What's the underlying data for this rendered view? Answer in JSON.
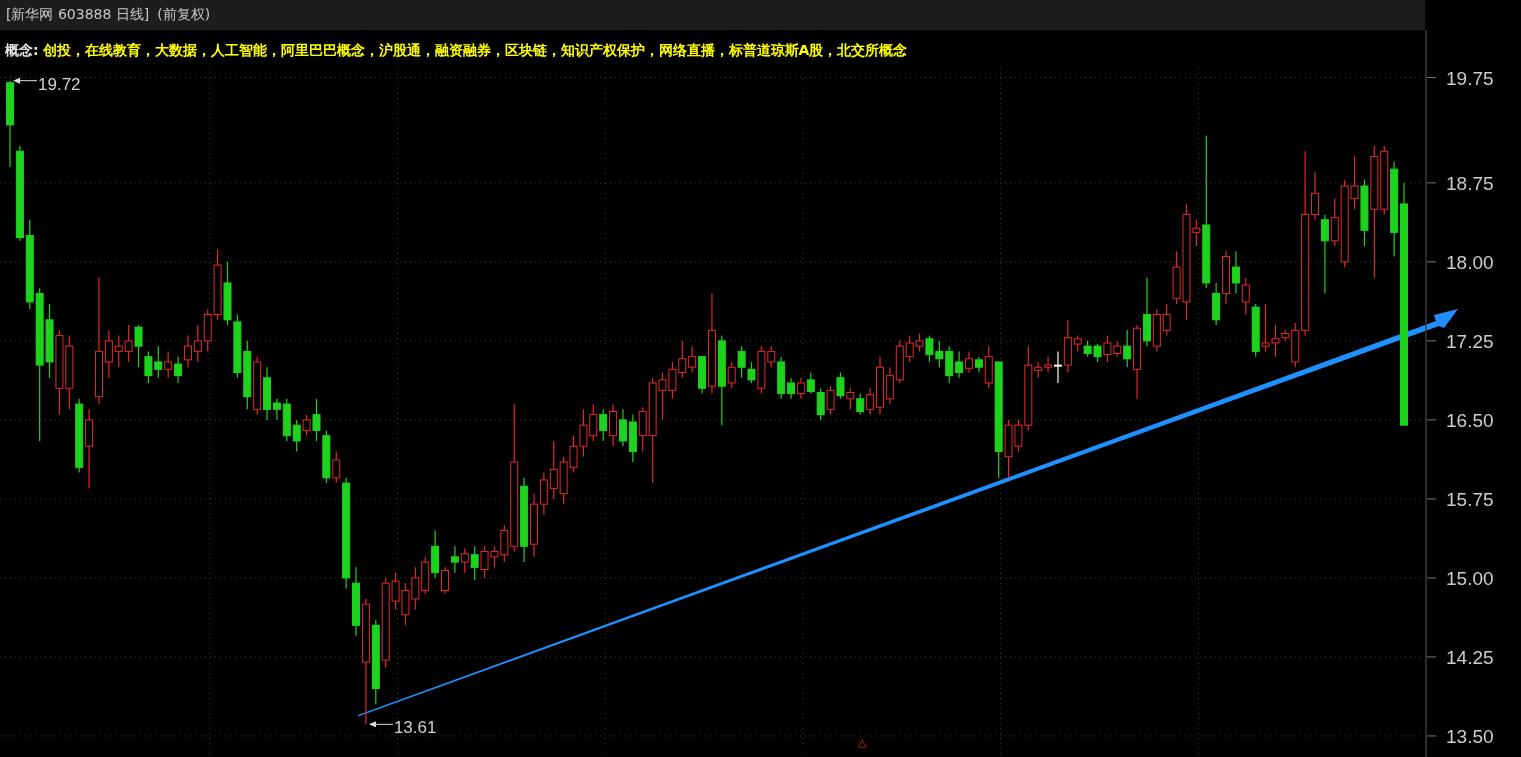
{
  "header": {
    "title": "[新华网 603888 日线]",
    "adjustment": "(前复权)"
  },
  "concepts": {
    "label": "概念:",
    "text": "创投，在线教育，大数据，人工智能，阿里巴巴概念，沪股通，融资融券，区块链，知识产权保护，网络直播，标普道琼斯A股，北交所概念"
  },
  "chart": {
    "bottom_marker": "△",
    "chart_data": {
      "type": "candlestick",
      "ylim": [
        13.3,
        20.48
      ],
      "grid": true,
      "yticks": [
        {
          "value": 19.75,
          "label": "19.75"
        },
        {
          "value": 18.75,
          "label": "18.75"
        },
        {
          "value": 18.0,
          "label": "18.00"
        },
        {
          "value": 17.25,
          "label": "17.25"
        },
        {
          "value": 16.5,
          "label": "16.50"
        },
        {
          "value": 15.75,
          "label": "15.75"
        },
        {
          "value": 15.0,
          "label": "15.00"
        },
        {
          "value": 14.25,
          "label": "14.25"
        },
        {
          "value": 13.5,
          "label": "13.50"
        }
      ],
      "ohlc": [
        [
          19.7,
          19.72,
          18.9,
          19.3
        ],
        [
          19.05,
          19.1,
          18.2,
          18.23
        ],
        [
          18.25,
          18.4,
          17.55,
          17.62
        ],
        [
          17.7,
          17.75,
          16.3,
          17.02
        ],
        [
          17.45,
          17.6,
          16.9,
          17.05
        ],
        [
          16.8,
          17.35,
          16.55,
          17.3
        ],
        [
          16.8,
          17.3,
          16.6,
          17.2
        ],
        [
          16.65,
          16.7,
          16.0,
          16.05
        ],
        [
          16.25,
          16.6,
          15.85,
          16.5
        ],
        [
          16.72,
          17.85,
          16.65,
          17.15
        ],
        [
          17.05,
          17.35,
          16.9,
          17.25
        ],
        [
          17.15,
          17.3,
          17.0,
          17.2
        ],
        [
          17.15,
          17.4,
          17.05,
          17.25
        ],
        [
          17.38,
          17.4,
          17.0,
          17.2
        ],
        [
          17.1,
          17.15,
          16.85,
          16.92
        ],
        [
          17.05,
          17.2,
          16.9,
          16.98
        ],
        [
          16.98,
          17.15,
          16.9,
          17.05
        ],
        [
          17.03,
          17.1,
          16.85,
          16.92
        ],
        [
          17.07,
          17.3,
          17.0,
          17.2
        ],
        [
          17.15,
          17.4,
          17.05,
          17.25
        ],
        [
          17.25,
          17.55,
          17.15,
          17.5
        ],
        [
          17.5,
          18.12,
          17.45,
          17.97
        ],
        [
          17.8,
          18.0,
          17.4,
          17.45
        ],
        [
          17.43,
          17.5,
          16.9,
          16.95
        ],
        [
          17.15,
          17.25,
          16.6,
          16.72
        ],
        [
          16.6,
          17.1,
          16.55,
          17.05
        ],
        [
          16.9,
          17.0,
          16.5,
          16.6
        ],
        [
          16.66,
          16.7,
          16.5,
          16.6
        ],
        [
          16.65,
          16.7,
          16.3,
          16.35
        ],
        [
          16.45,
          16.5,
          16.2,
          16.3
        ],
        [
          16.4,
          16.55,
          16.35,
          16.5
        ],
        [
          16.55,
          16.7,
          16.3,
          16.4
        ],
        [
          16.35,
          16.4,
          15.9,
          15.95
        ],
        [
          15.95,
          16.2,
          15.9,
          16.12
        ],
        [
          15.9,
          15.95,
          14.9,
          15.0
        ],
        [
          14.95,
          15.1,
          14.45,
          14.55
        ],
        [
          14.2,
          14.8,
          13.61,
          14.75
        ],
        [
          14.55,
          14.6,
          13.8,
          13.95
        ],
        [
          14.22,
          15.0,
          14.15,
          14.95
        ],
        [
          14.78,
          15.05,
          14.7,
          14.97
        ],
        [
          14.65,
          14.95,
          14.55,
          14.88
        ],
        [
          14.8,
          15.1,
          14.7,
          15.0
        ],
        [
          14.88,
          15.2,
          14.85,
          15.15
        ],
        [
          15.3,
          15.45,
          15.0,
          15.05
        ],
        [
          14.88,
          15.1,
          14.85,
          15.07
        ],
        [
          15.2,
          15.3,
          15.05,
          15.15
        ],
        [
          15.15,
          15.28,
          15.05,
          15.23
        ],
        [
          15.22,
          15.3,
          14.98,
          15.1
        ],
        [
          15.08,
          15.3,
          15.0,
          15.25
        ],
        [
          15.2,
          15.3,
          15.1,
          15.25
        ],
        [
          15.22,
          15.5,
          15.15,
          15.45
        ],
        [
          15.3,
          16.65,
          15.25,
          16.1
        ],
        [
          15.87,
          15.95,
          15.15,
          15.3
        ],
        [
          15.32,
          15.8,
          15.2,
          15.7
        ],
        [
          15.7,
          16.0,
          15.6,
          15.93
        ],
        [
          15.85,
          16.3,
          15.75,
          16.03
        ],
        [
          15.8,
          16.15,
          15.7,
          16.1
        ],
        [
          16.05,
          16.35,
          16.0,
          16.25
        ],
        [
          16.25,
          16.6,
          16.15,
          16.45
        ],
        [
          16.35,
          16.65,
          16.3,
          16.55
        ],
        [
          16.55,
          16.6,
          16.3,
          16.4
        ],
        [
          16.35,
          16.65,
          16.25,
          16.58
        ],
        [
          16.5,
          16.6,
          16.25,
          16.3
        ],
        [
          16.48,
          16.55,
          16.1,
          16.2
        ],
        [
          16.35,
          16.62,
          16.2,
          16.58
        ],
        [
          16.35,
          16.9,
          15.9,
          16.85
        ],
        [
          16.78,
          16.95,
          16.5,
          16.88
        ],
        [
          16.78,
          17.05,
          16.7,
          16.98
        ],
        [
          16.95,
          17.25,
          16.9,
          17.08
        ],
        [
          17.0,
          17.2,
          16.95,
          17.1
        ],
        [
          17.1,
          17.1,
          16.75,
          16.8
        ],
        [
          16.82,
          17.7,
          16.75,
          17.35
        ],
        [
          17.25,
          17.3,
          16.45,
          16.82
        ],
        [
          16.85,
          17.05,
          16.8,
          17.0
        ],
        [
          17.15,
          17.2,
          16.9,
          17.0
        ],
        [
          16.98,
          17.05,
          16.85,
          16.88
        ],
        [
          16.8,
          17.2,
          16.75,
          17.15
        ],
        [
          17.05,
          17.2,
          17.0,
          17.15
        ],
        [
          17.05,
          17.1,
          16.7,
          16.75
        ],
        [
          16.85,
          16.9,
          16.7,
          16.75
        ],
        [
          16.75,
          16.9,
          16.7,
          16.85
        ],
        [
          16.88,
          16.95,
          16.75,
          16.77
        ],
        [
          16.76,
          16.8,
          16.5,
          16.55
        ],
        [
          16.6,
          16.82,
          16.55,
          16.78
        ],
        [
          16.9,
          16.95,
          16.7,
          16.73
        ],
        [
          16.7,
          16.8,
          16.6,
          16.76
        ],
        [
          16.7,
          16.75,
          16.55,
          16.58
        ],
        [
          16.6,
          16.8,
          16.55,
          16.74
        ],
        [
          16.62,
          17.1,
          16.55,
          17.0
        ],
        [
          16.7,
          17.0,
          16.65,
          16.92
        ],
        [
          16.88,
          17.25,
          16.85,
          17.2
        ],
        [
          17.1,
          17.3,
          17.05,
          17.23
        ],
        [
          17.2,
          17.32,
          17.15,
          17.25
        ],
        [
          17.27,
          17.3,
          17.05,
          17.12
        ],
        [
          17.15,
          17.25,
          17.0,
          17.08
        ],
        [
          17.15,
          17.2,
          16.85,
          16.92
        ],
        [
          17.05,
          17.15,
          16.9,
          16.95
        ],
        [
          16.99,
          17.15,
          16.95,
          17.08
        ],
        [
          17.07,
          17.1,
          16.95,
          17.0
        ],
        [
          16.85,
          17.2,
          16.8,
          17.1
        ],
        [
          17.05,
          17.05,
          15.95,
          16.2
        ],
        [
          16.15,
          16.5,
          15.95,
          16.45
        ],
        [
          16.25,
          16.5,
          16.2,
          16.45
        ],
        [
          16.45,
          17.2,
          16.4,
          17.02
        ],
        [
          16.97,
          17.05,
          16.9,
          17.0
        ],
        [
          17.0,
          17.1,
          16.95,
          17.02
        ],
        [
          17.02,
          17.15,
          16.85,
          17.02
        ],
        [
          17.02,
          17.45,
          16.95,
          17.28
        ],
        [
          17.22,
          17.3,
          17.15,
          17.27
        ],
        [
          17.2,
          17.25,
          17.1,
          17.13
        ],
        [
          17.2,
          17.22,
          17.05,
          17.1
        ],
        [
          17.12,
          17.3,
          17.05,
          17.23
        ],
        [
          17.13,
          17.25,
          17.1,
          17.2
        ],
        [
          17.2,
          17.35,
          17.0,
          17.08
        ],
        [
          16.98,
          17.4,
          16.7,
          17.37
        ],
        [
          17.5,
          17.85,
          17.2,
          17.25
        ],
        [
          17.2,
          17.55,
          17.15,
          17.5
        ],
        [
          17.35,
          17.6,
          17.3,
          17.5
        ],
        [
          17.65,
          18.1,
          17.6,
          17.95
        ],
        [
          17.62,
          18.55,
          17.45,
          18.45
        ],
        [
          18.28,
          18.4,
          18.15,
          18.32
        ],
        [
          18.35,
          19.2,
          17.75,
          17.8
        ],
        [
          17.7,
          17.8,
          17.4,
          17.45
        ],
        [
          17.7,
          18.1,
          17.6,
          18.05
        ],
        [
          17.95,
          18.1,
          17.7,
          17.8
        ],
        [
          17.62,
          17.85,
          17.5,
          17.78
        ],
        [
          17.57,
          17.6,
          17.1,
          17.15
        ],
        [
          17.2,
          17.6,
          17.15,
          17.23
        ],
        [
          17.23,
          17.4,
          17.1,
          17.27
        ],
        [
          17.28,
          17.35,
          17.25,
          17.32
        ],
        [
          17.05,
          17.42,
          17.0,
          17.35
        ],
        [
          17.35,
          19.05,
          17.3,
          18.45
        ],
        [
          18.45,
          18.85,
          18.4,
          18.65
        ],
        [
          18.4,
          18.45,
          17.7,
          18.2
        ],
        [
          18.2,
          18.6,
          18.15,
          18.42
        ],
        [
          18.0,
          18.78,
          17.95,
          18.72
        ],
        [
          18.6,
          19.0,
          18.5,
          18.72
        ],
        [
          18.72,
          18.78,
          18.15,
          18.3
        ],
        [
          18.5,
          19.1,
          17.85,
          19.0
        ],
        [
          18.5,
          19.1,
          18.45,
          19.05
        ],
        [
          18.88,
          18.95,
          18.05,
          18.28
        ],
        [
          18.55,
          18.75,
          16.45,
          16.45
        ]
      ],
      "annotations": [
        "19.72",
        "13.61"
      ]
    }
  }
}
